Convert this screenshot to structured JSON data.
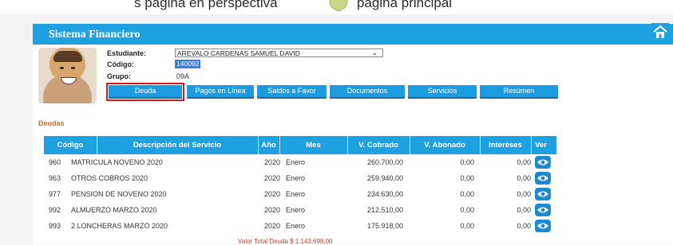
{
  "browser_caption": {
    "left": "s página en perspectiva",
    "right": "página principal"
  },
  "header": {
    "title": "Sistema Financiero"
  },
  "student": {
    "estudiante_label": "Estudiante:",
    "estudiante_value": "AREVALO CARDENAS SAMUEL DAVID",
    "codigo_label": "Código:",
    "codigo_value": "140092",
    "grupo_label": "Grupo:",
    "grupo_value": "09A"
  },
  "tabs": [
    "Deuda",
    "Pagos en Línea",
    "Saldos a Favor",
    "Documentos",
    "Servicios",
    "Resúmen"
  ],
  "section_title": "Deudas",
  "table": {
    "headers": [
      "Código",
      "Descripción del Servicio",
      "Año",
      "Mes",
      "V. Cobrado",
      "V. Abonado",
      "Interéses",
      "Ver"
    ],
    "rows": [
      [
        "960",
        "MATRICULA NOVENO 2020",
        "2020",
        "Enero",
        "260.700,00",
        "0,00",
        "0,00"
      ],
      [
        "963",
        "OTROS COBROS 2020",
        "2020",
        "Enero",
        "259.940,00",
        "0,00",
        "0,00"
      ],
      [
        "977",
        "PENSION DE NOVENO 2020",
        "2020",
        "Enero",
        "234.630,00",
        "0,00",
        "0,00"
      ],
      [
        "992",
        "ALMUERZO MARZO 2020",
        "2020",
        "Enero",
        "212.510,00",
        "0,00",
        "0,00"
      ],
      [
        "993",
        "2 LONCHERAS MARZO 2020",
        "2020",
        "Enero",
        "175.918,00",
        "0,00",
        "0,00"
      ]
    ]
  },
  "footer_text": "Valor Total Deuda $ 1.143.698,00",
  "colors": {
    "header_blue": "#1da1e0",
    "tab_blue": "#1c9ce0",
    "section_orange": "#d2691e",
    "highlight_red": "#d01a1a"
  }
}
